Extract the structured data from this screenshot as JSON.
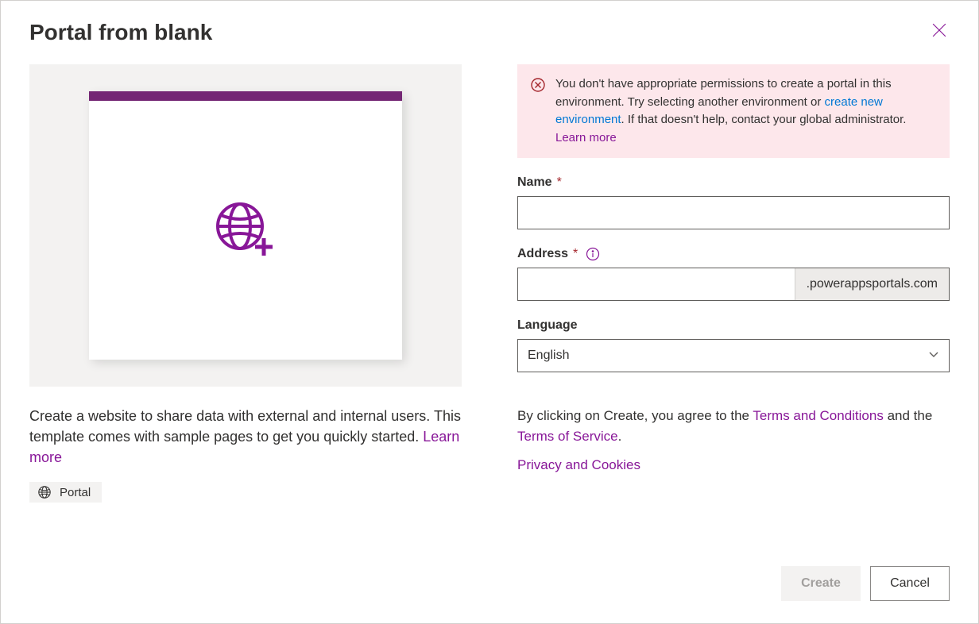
{
  "dialog": {
    "title": "Portal from blank"
  },
  "preview": {
    "description_text": "Create a website to share data with external and internal users. This template comes with sample pages to get you quickly started. ",
    "learn_more_label": "Learn more",
    "badge_label": "Portal"
  },
  "error": {
    "text_part1": "You don't have appropriate permissions to create a portal in this environment. Try selecting another environment or ",
    "create_env_link": "create new environment",
    "text_part2": ". If that doesn't help, contact your global administrator. ",
    "learn_more_label": "Learn more"
  },
  "form": {
    "name_label": "Name",
    "name_value": "",
    "address_label": "Address",
    "address_value": "",
    "address_suffix": ".powerappsportals.com",
    "language_label": "Language",
    "language_value": "English"
  },
  "terms": {
    "agree_prefix": "By clicking on Create, you agree to the ",
    "terms_conditions": "Terms and Conditions",
    "agree_mid": " and the ",
    "terms_service": "Terms of Service",
    "agree_suffix": ".",
    "privacy_label": "Privacy and Cookies"
  },
  "buttons": {
    "create": "Create",
    "cancel": "Cancel"
  }
}
